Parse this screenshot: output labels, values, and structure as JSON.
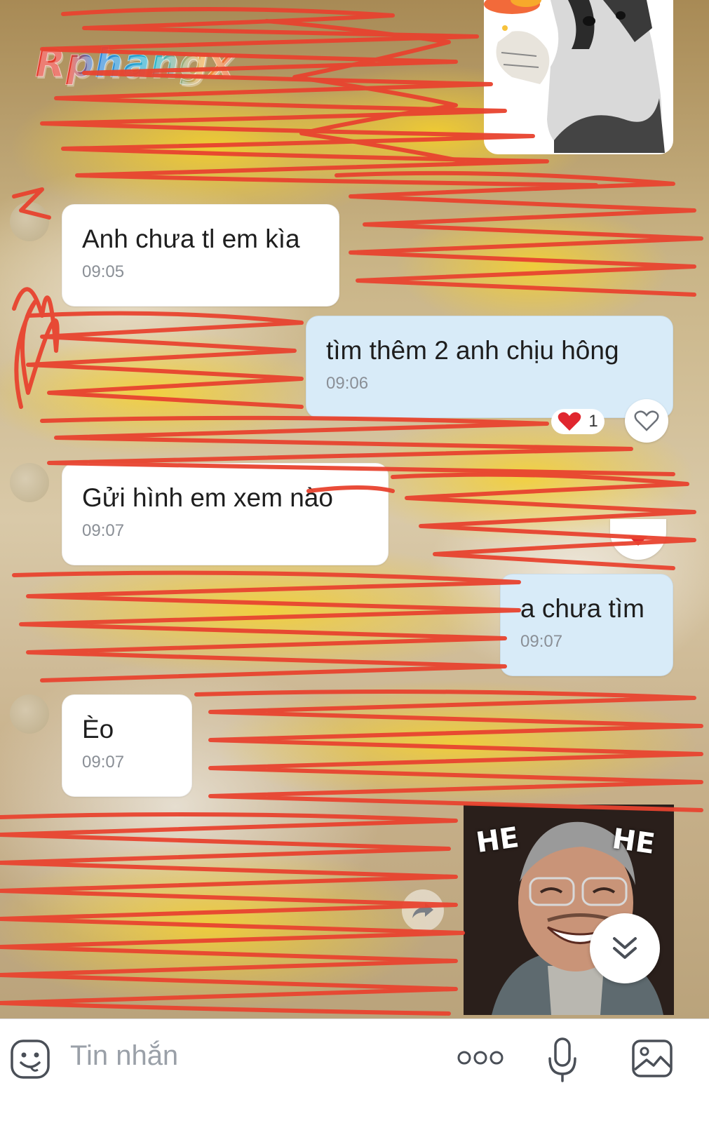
{
  "header": {
    "logo_text": "Rphangx"
  },
  "messages": [
    {
      "direction": "in",
      "text": "Anh chưa tl em kìa",
      "time": "09:05"
    },
    {
      "direction": "out",
      "text": "tìm thêm 2 anh chịu hông",
      "time": "09:06",
      "reaction": {
        "icon": "heart",
        "count": "1"
      }
    },
    {
      "direction": "in",
      "text": "Gửi hình em xem nào",
      "time": "09:07"
    },
    {
      "direction": "out",
      "text": "a chưa tìm",
      "time": "09:07"
    },
    {
      "direction": "in",
      "text": "Èo",
      "time": "09:07"
    }
  ],
  "stickers": {
    "he": {
      "left_text": "HE",
      "right_text": "HE"
    }
  },
  "input": {
    "placeholder": "Tin nhắn"
  },
  "colors": {
    "incoming_bubble": "#ffffff",
    "outgoing_bubble": "#d8ebf8",
    "scribble": "#e8432f",
    "highlight": "#f8d228",
    "icon": "#4a4f57"
  }
}
